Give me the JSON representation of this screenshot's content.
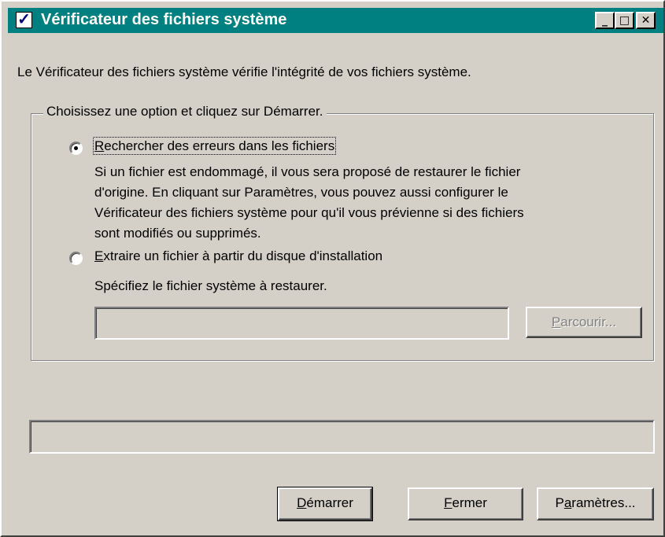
{
  "window": {
    "title": "Vérificateur des fichiers système",
    "title_icon": "checkbox-check-icon",
    "titlebar_color": "#008080",
    "controls": {
      "minimize": "_",
      "maximize": "□",
      "close": "✕"
    }
  },
  "intro_text": "Le Vérificateur des fichiers système vérifie l'intégrité de vos fichiers système.",
  "group": {
    "legend": "Choisissez une option et cliquez sur Démarrer.",
    "option1": {
      "accel": "R",
      "label_rest": "echercher des erreurs dans les fichiers",
      "selected": true,
      "description": [
        "Si un fichier est endommagé, il vous sera proposé de restaurer le fichier",
        "d'origine. En cliquant sur Paramètres, vous pouvez aussi configurer le",
        "Vérificateur des fichiers système pour qu'il vous prévienne si des fichiers",
        "sont modifiés ou supprimés."
      ]
    },
    "option2": {
      "accel": "E",
      "label_rest": "xtraire un fichier à partir du disque d'installation",
      "selected": false,
      "description": "Spécifiez le fichier système à restaurer.",
      "file_value": "",
      "browse": {
        "accel": "P",
        "rest": "arcourir...",
        "enabled": false
      }
    }
  },
  "progress": {
    "value": 0
  },
  "buttons": {
    "start": {
      "accel": "D",
      "rest": "émarrer"
    },
    "close": {
      "accel": "F",
      "rest": "ermer"
    },
    "settings": {
      "pre": "P",
      "accel": "a",
      "rest": "ramètres..."
    }
  }
}
